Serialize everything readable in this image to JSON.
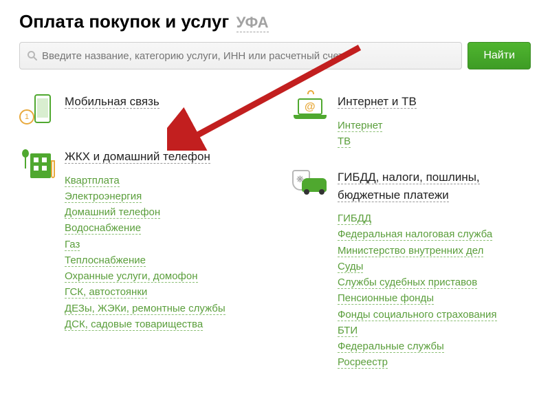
{
  "header": {
    "title": "Оплата покупок и услуг",
    "city": "УФА"
  },
  "search": {
    "placeholder": "Введите название, категорию услуги, ИНН или расчетный счет",
    "button": "Найти"
  },
  "colLeft": [
    {
      "title": "Мобильная связь",
      "links": []
    },
    {
      "title": "ЖКХ и домашний телефон",
      "links": [
        "Квартплата",
        "Электроэнергия",
        "Домашний телефон",
        "Водоснабжение",
        "Газ",
        "Теплоснабжение",
        "Охранные услуги, домофон",
        "ГСК, автостоянки",
        "ДЕЗы, ЖЭКи, ремонтные службы",
        "ДСК, садовые товарищества"
      ]
    }
  ],
  "colRight": [
    {
      "title": "Интернет и ТВ",
      "links": [
        "Интернет",
        "ТВ"
      ]
    },
    {
      "title": "ГИБДД, налоги, пошлины, бюджетные платежи",
      "links": [
        "ГИБДД",
        "Федеральная налоговая служба",
        "Министерство внутренних дел",
        "Суды",
        "Службы судебных приставов",
        "Пенсионные фонды",
        "Фонды социального страхования",
        "БТИ",
        "Федеральные службы",
        "Росреестр"
      ]
    }
  ]
}
